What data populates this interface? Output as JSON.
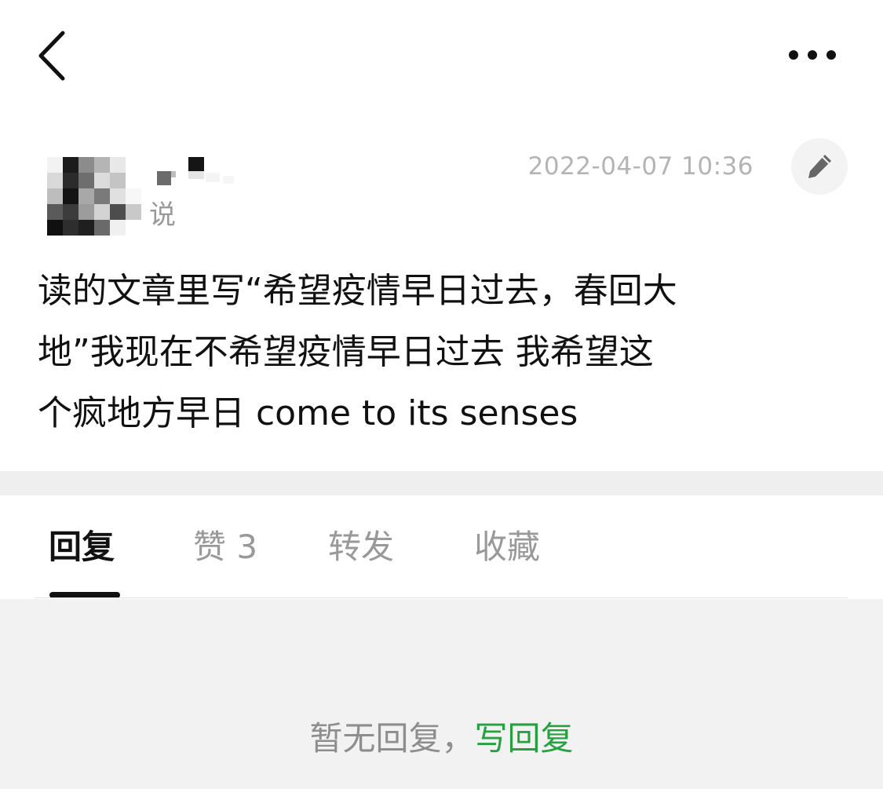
{
  "top_bar": {
    "back_icon": "chevron-left-icon",
    "more_icon": "more-horizontal-icon"
  },
  "post": {
    "author_verb": "说",
    "date": "2022-04-07 10:36",
    "edit_icon": "pencil-icon",
    "content": "读的文章里写“希望疫情早日过去，春回大\n地”我现在不希望疫情早日过去 我希望这\n个疯地方早日 come to its senses"
  },
  "tabs": [
    {
      "label": "回复",
      "active": true
    },
    {
      "label": "赞 3",
      "active": false
    },
    {
      "label": "转发",
      "active": false
    },
    {
      "label": "收藏",
      "active": false
    }
  ],
  "replies": {
    "empty_text": "暂无回复，",
    "write_reply_label": "写回复"
  },
  "colors": {
    "accent_green": "#27a140",
    "text_primary": "#111111",
    "text_muted": "#999999",
    "separator": "#efefef"
  }
}
